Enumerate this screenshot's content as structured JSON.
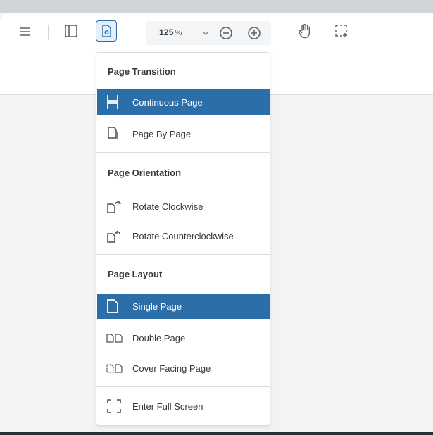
{
  "toolbar": {
    "zoom_value": "125",
    "zoom_unit": "%",
    "icons": [
      "menu-icon",
      "sidebar-icon",
      "page-settings-icon",
      "chevron-down-icon",
      "zoom-out-icon",
      "zoom-in-icon",
      "pan-hand-icon",
      "marquee-select-icon"
    ]
  },
  "menu": {
    "transition": {
      "heading": "Page Transition",
      "items": [
        {
          "label": "Continuous Page",
          "selected": true
        },
        {
          "label": "Page By Page",
          "selected": false
        }
      ]
    },
    "orientation": {
      "heading": "Page Orientation",
      "items": [
        {
          "label": "Rotate Clockwise"
        },
        {
          "label": "Rotate Counterclockwise"
        }
      ]
    },
    "layout": {
      "heading": "Page Layout",
      "items": [
        {
          "label": "Single Page",
          "selected": true
        },
        {
          "label": "Double Page",
          "selected": false
        },
        {
          "label": "Cover Facing Page",
          "selected": false
        }
      ]
    },
    "fullscreen": {
      "label": "Enter Full Screen"
    }
  },
  "colors": {
    "accent": "#2c6ea8",
    "toolbar_bg": "#ffffff",
    "canvas_bg": "#f1f3f5"
  }
}
